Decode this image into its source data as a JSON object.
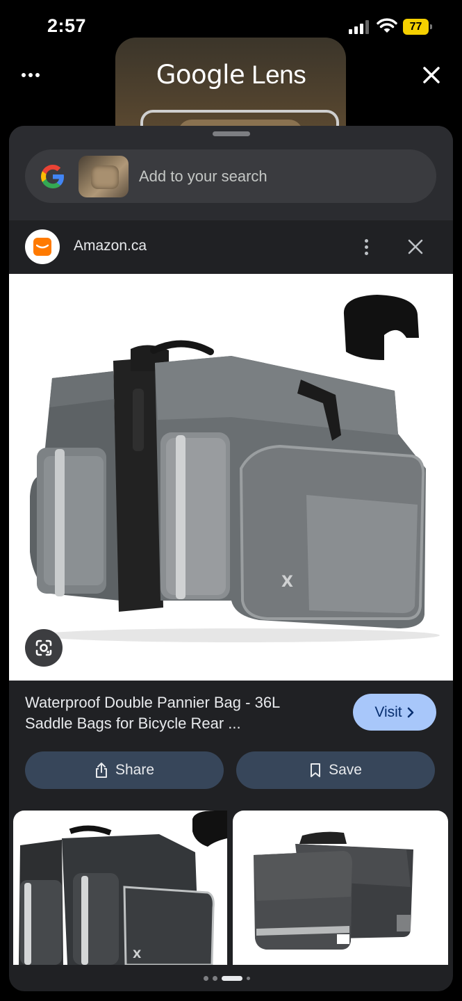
{
  "status_bar": {
    "time": "2:57",
    "battery": "77"
  },
  "header": {
    "title_google": "Google",
    "title_lens": "Lens"
  },
  "search": {
    "placeholder": "Add to your search"
  },
  "result": {
    "source": "Amazon.ca",
    "title": "Waterproof Double Pannier Bag - 36L Saddle Bags for Bicycle Rear ...",
    "visit_label": "Visit",
    "share_label": "Share",
    "save_label": "Save"
  },
  "colors": {
    "sheet_bg": "#202124",
    "visit_bg": "#a8c7fa",
    "action_bg": "#37465a",
    "amazon_orange": "#ff7a00",
    "battery_yellow": "#f5d000"
  },
  "icons": [
    "more-horizontal-icon",
    "close-icon",
    "google-g-icon",
    "more-vert-icon",
    "share-icon",
    "bookmark-icon",
    "chevron-right-icon",
    "lens-icon",
    "wifi-icon",
    "cellular-signal-icon",
    "battery-icon"
  ],
  "pager": {
    "count": 4,
    "active_index": 2
  }
}
